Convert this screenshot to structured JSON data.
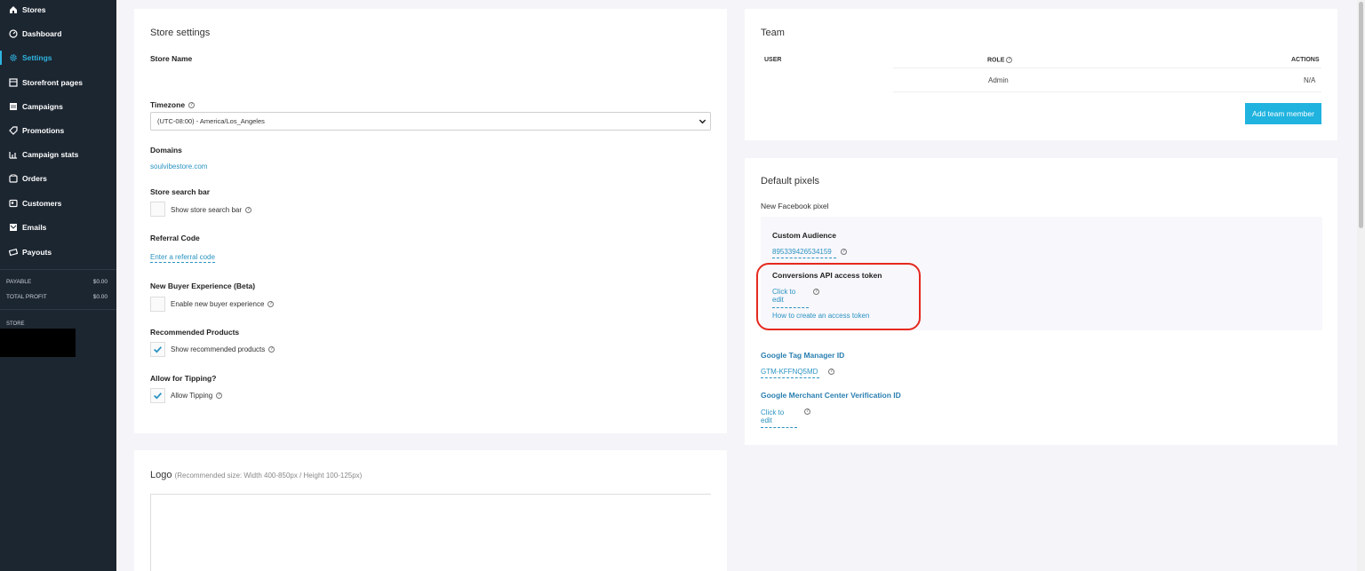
{
  "sidebar": {
    "items": [
      {
        "label": "Stores",
        "icon": "home-icon"
      },
      {
        "label": "Dashboard",
        "icon": "gauge-icon"
      },
      {
        "label": "Settings",
        "icon": "gear-icon",
        "active": true
      },
      {
        "label": "Storefront pages",
        "icon": "page-icon"
      },
      {
        "label": "Campaigns",
        "icon": "campaign-icon"
      },
      {
        "label": "Promotions",
        "icon": "tag-icon"
      },
      {
        "label": "Campaign stats",
        "icon": "bar-chart-icon"
      },
      {
        "label": "Orders",
        "icon": "orders-icon"
      },
      {
        "label": "Customers",
        "icon": "customers-icon"
      },
      {
        "label": "Emails",
        "icon": "email-icon"
      },
      {
        "label": "Payouts",
        "icon": "money-icon"
      }
    ],
    "stats": [
      {
        "label": "PAYABLE",
        "value": "$0.00"
      },
      {
        "label": "TOTAL PROFIT",
        "value": "$0.00"
      }
    ],
    "store_label": "STORE"
  },
  "store_settings": {
    "title": "Store settings",
    "store_name_label": "Store Name",
    "timezone_label": "Timezone",
    "timezone_value": "(UTC-08:00) - America/Los_Angeles",
    "domains_label": "Domains",
    "domain_value": "soulvibestore.com",
    "search_bar_label": "Store search bar",
    "search_bar_checkbox": "Show store search bar",
    "referral_label": "Referral Code",
    "referral_link": "Enter a referral code",
    "new_buyer_label": "New Buyer Experience (Beta)",
    "new_buyer_checkbox": "Enable new buyer experience",
    "recommended_label": "Recommended Products",
    "recommended_checkbox": "Show recommended products",
    "tipping_label": "Allow for Tipping?",
    "tipping_checkbox": "Allow Tipping"
  },
  "logo": {
    "title": "Logo",
    "hint": "(Recommended size: Width 400-850px / Height 100-125px)"
  },
  "team": {
    "title": "Team",
    "columns": [
      "USER",
      "ROLE",
      "ACTIONS"
    ],
    "rows": [
      {
        "user": "",
        "role": "Admin",
        "actions": "N/A"
      }
    ],
    "add_button": "Add team member"
  },
  "pixels": {
    "title": "Default pixels",
    "facebook_label": "New Facebook pixel",
    "custom_audience_label": "Custom Audience",
    "custom_audience_value": "895339426534159",
    "capi_label": "Conversions API access token",
    "capi_edit": "Click to edit",
    "capi_howto": "How to create an access token",
    "gtm_label": "Google Tag Manager ID",
    "gtm_value": "GTM-KFFNQ5MD",
    "gmc_label": "Google Merchant Center Verification ID",
    "gmc_edit": "Click to edit"
  },
  "colors": {
    "sidebar_bg": "#1c2631",
    "accent": "#2fb4e0",
    "primary_button": "#20b3df",
    "highlight": "#e5291f"
  }
}
